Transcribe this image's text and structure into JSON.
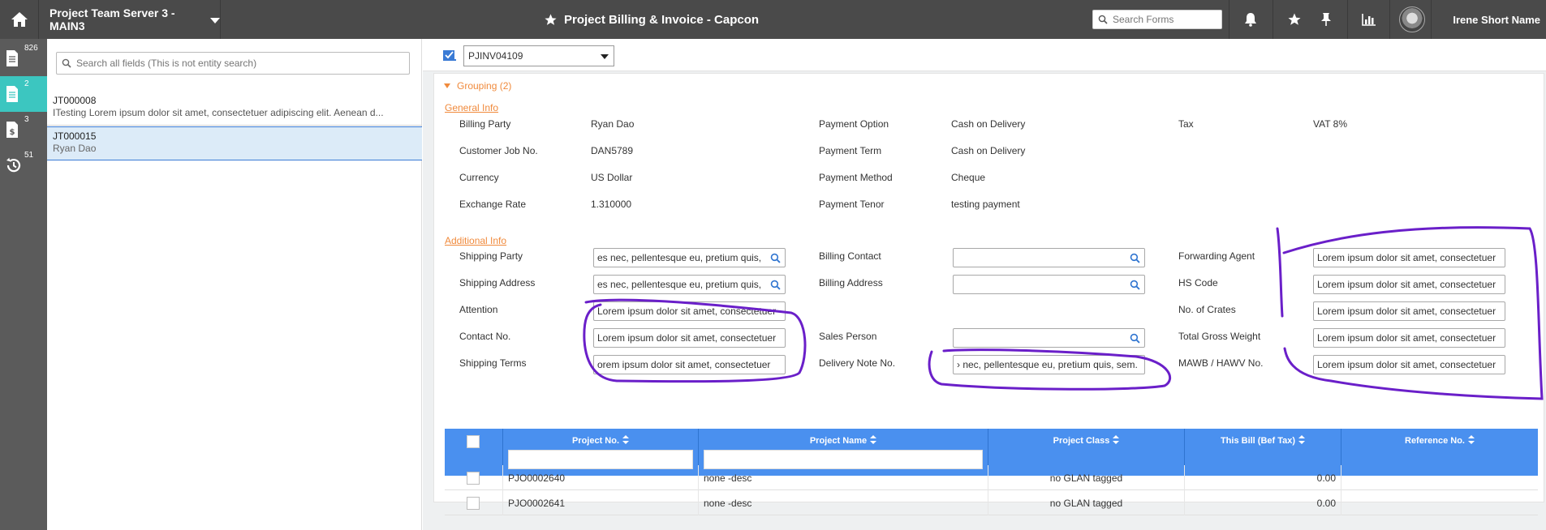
{
  "topbar": {
    "server": "Project Team Server 3 - MAIN3",
    "title": "Project Billing & Invoice - Capcon",
    "search_placeholder": "Search Forms",
    "user_name": "Irene Short Name"
  },
  "rail": {
    "items": [
      {
        "icon": "document-icon",
        "count": "826"
      },
      {
        "icon": "document-list-icon",
        "count": "2"
      },
      {
        "icon": "invoice-dollar-icon",
        "count": "3"
      },
      {
        "icon": "history-icon",
        "count": "51"
      }
    ]
  },
  "list": {
    "search_placeholder": "Search all fields (This is not entity search)",
    "items": [
      {
        "code": "JT000008",
        "desc": "ITesting Lorem ipsum dolor sit amet, consectetuer adipiscing elit. Aenean d..."
      },
      {
        "code": "JT000015",
        "desc": "Ryan Dao"
      }
    ]
  },
  "record": {
    "selected": "PJINV04109"
  },
  "form": {
    "grouping": "Grouping (2)",
    "general_title": "General Info",
    "general": {
      "billing_party_label": "Billing Party",
      "billing_party": "Ryan Dao",
      "customer_job_label": "Customer Job No.",
      "customer_job": "DAN5789",
      "currency_label": "Currency",
      "currency": "US Dollar",
      "exchange_rate_label": "Exchange Rate",
      "exchange_rate": "1.310000",
      "payment_option_label": "Payment Option",
      "payment_option": "Cash on Delivery",
      "payment_term_label": "Payment Term",
      "payment_term": "Cash on Delivery",
      "payment_method_label": "Payment Method",
      "payment_method": "Cheque",
      "payment_tenor_label": "Payment Tenor",
      "payment_tenor": "testing payment",
      "tax_label": "Tax",
      "tax": "VAT 8%"
    },
    "additional_title": "Additional Info",
    "additional": {
      "shipping_party_label": "Shipping Party",
      "shipping_party": "es nec, pellentesque eu, pretium quis,",
      "shipping_address_label": "Shipping Address",
      "shipping_address": "es nec, pellentesque eu, pretium quis,",
      "attention_label": "Attention",
      "attention": "Lorem ipsum dolor sit amet, consectetuer",
      "contact_label": "Contact No.",
      "contact": "Lorem ipsum dolor sit amet, consectetuer",
      "shipping_terms_label": "Shipping Terms",
      "shipping_terms": "orem ipsum dolor sit amet, consectetuer",
      "billing_contact_label": "Billing Contact",
      "billing_contact": "",
      "billing_address_label": "Billing Address",
      "billing_address": "",
      "sales_person_label": "Sales Person",
      "sales_person": "",
      "delivery_note_label": "Delivery Note No.",
      "delivery_note": "› nec, pellentesque eu, pretium quis, sem.",
      "forwarding_agent_label": "Forwarding Agent",
      "forwarding_agent": "Lorem ipsum dolor sit amet, consectetuer",
      "hs_code_label": "HS Code",
      "hs_code": "Lorem ipsum dolor sit amet, consectetuer",
      "crates_label": "No. of Crates",
      "crates": "Lorem ipsum dolor sit amet, consectetuer",
      "gross_weight_label": "Total Gross Weight",
      "gross_weight": "Lorem ipsum dolor sit amet, consectetuer",
      "mawb_label": "MAWB / HAWV No.",
      "mawb": "Lorem ipsum dolor sit amet, consectetuer"
    }
  },
  "grid": {
    "columns": [
      "Project No.",
      "Project Name",
      "Project Class",
      "This Bill (Bef Tax)",
      "Reference No."
    ],
    "rows": [
      {
        "project_no": "PJO0002640",
        "project_name": "none -desc",
        "project_class": "no GLAN tagged",
        "this_bill": "0.00",
        "reference": ""
      },
      {
        "project_no": "PJO0002641",
        "project_name": "none -desc",
        "project_class": "no GLAN tagged",
        "this_bill": "0.00",
        "reference": ""
      }
    ]
  },
  "colors": {
    "topbar": "#4a4a4a",
    "rail": "#5b5b5b",
    "rail_active": "#3cc6c0",
    "accent_orange": "#f08a3c",
    "grid_header": "#4a90ef",
    "annotation": "#6a1fc9"
  }
}
